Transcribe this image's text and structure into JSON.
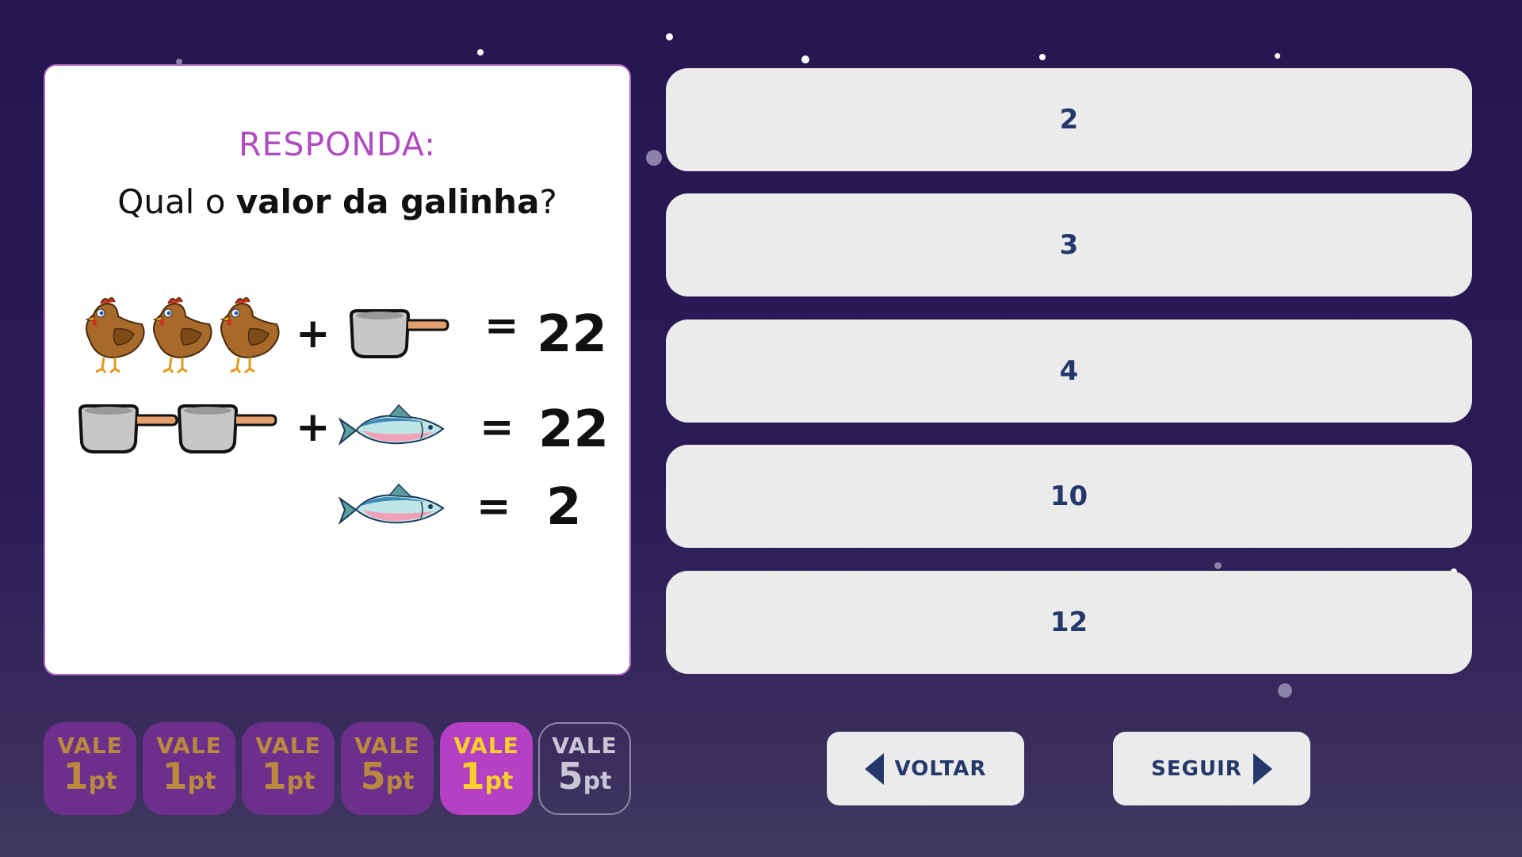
{
  "question": {
    "prompt": "RESPONDA:",
    "text_before": "Qual o ",
    "text_bold": "valor da galinha",
    "text_after": "?"
  },
  "equations": [
    {
      "left": [
        "chicken",
        "chicken",
        "chicken",
        "+",
        "pot"
      ],
      "equals": "=",
      "result": "22"
    },
    {
      "left": [
        "pot",
        "pot",
        "+",
        "fish"
      ],
      "equals": "=",
      "result": "22"
    },
    {
      "left": [
        "fish"
      ],
      "equals": "=",
      "result": "2"
    }
  ],
  "answers": [
    "2",
    "3",
    "4",
    "10",
    "12"
  ],
  "points": [
    {
      "label": "VALE",
      "value": "1",
      "unit": "pt",
      "state": "done"
    },
    {
      "label": "VALE",
      "value": "1",
      "unit": "pt",
      "state": "done"
    },
    {
      "label": "VALE",
      "value": "1",
      "unit": "pt",
      "state": "done"
    },
    {
      "label": "VALE",
      "value": "5",
      "unit": "pt",
      "state": "done"
    },
    {
      "label": "VALE",
      "value": "1",
      "unit": "pt",
      "state": "active"
    },
    {
      "label": "VALE",
      "value": "5",
      "unit": "pt",
      "state": "locked"
    }
  ],
  "nav": {
    "back_label": "VOLTAR",
    "next_label": "SEGUIR"
  },
  "icons": {
    "back": "arrow-left-icon",
    "next": "arrow-right-icon",
    "chicken": "chicken-icon",
    "pot": "pot-icon",
    "fish": "fish-icon"
  }
}
